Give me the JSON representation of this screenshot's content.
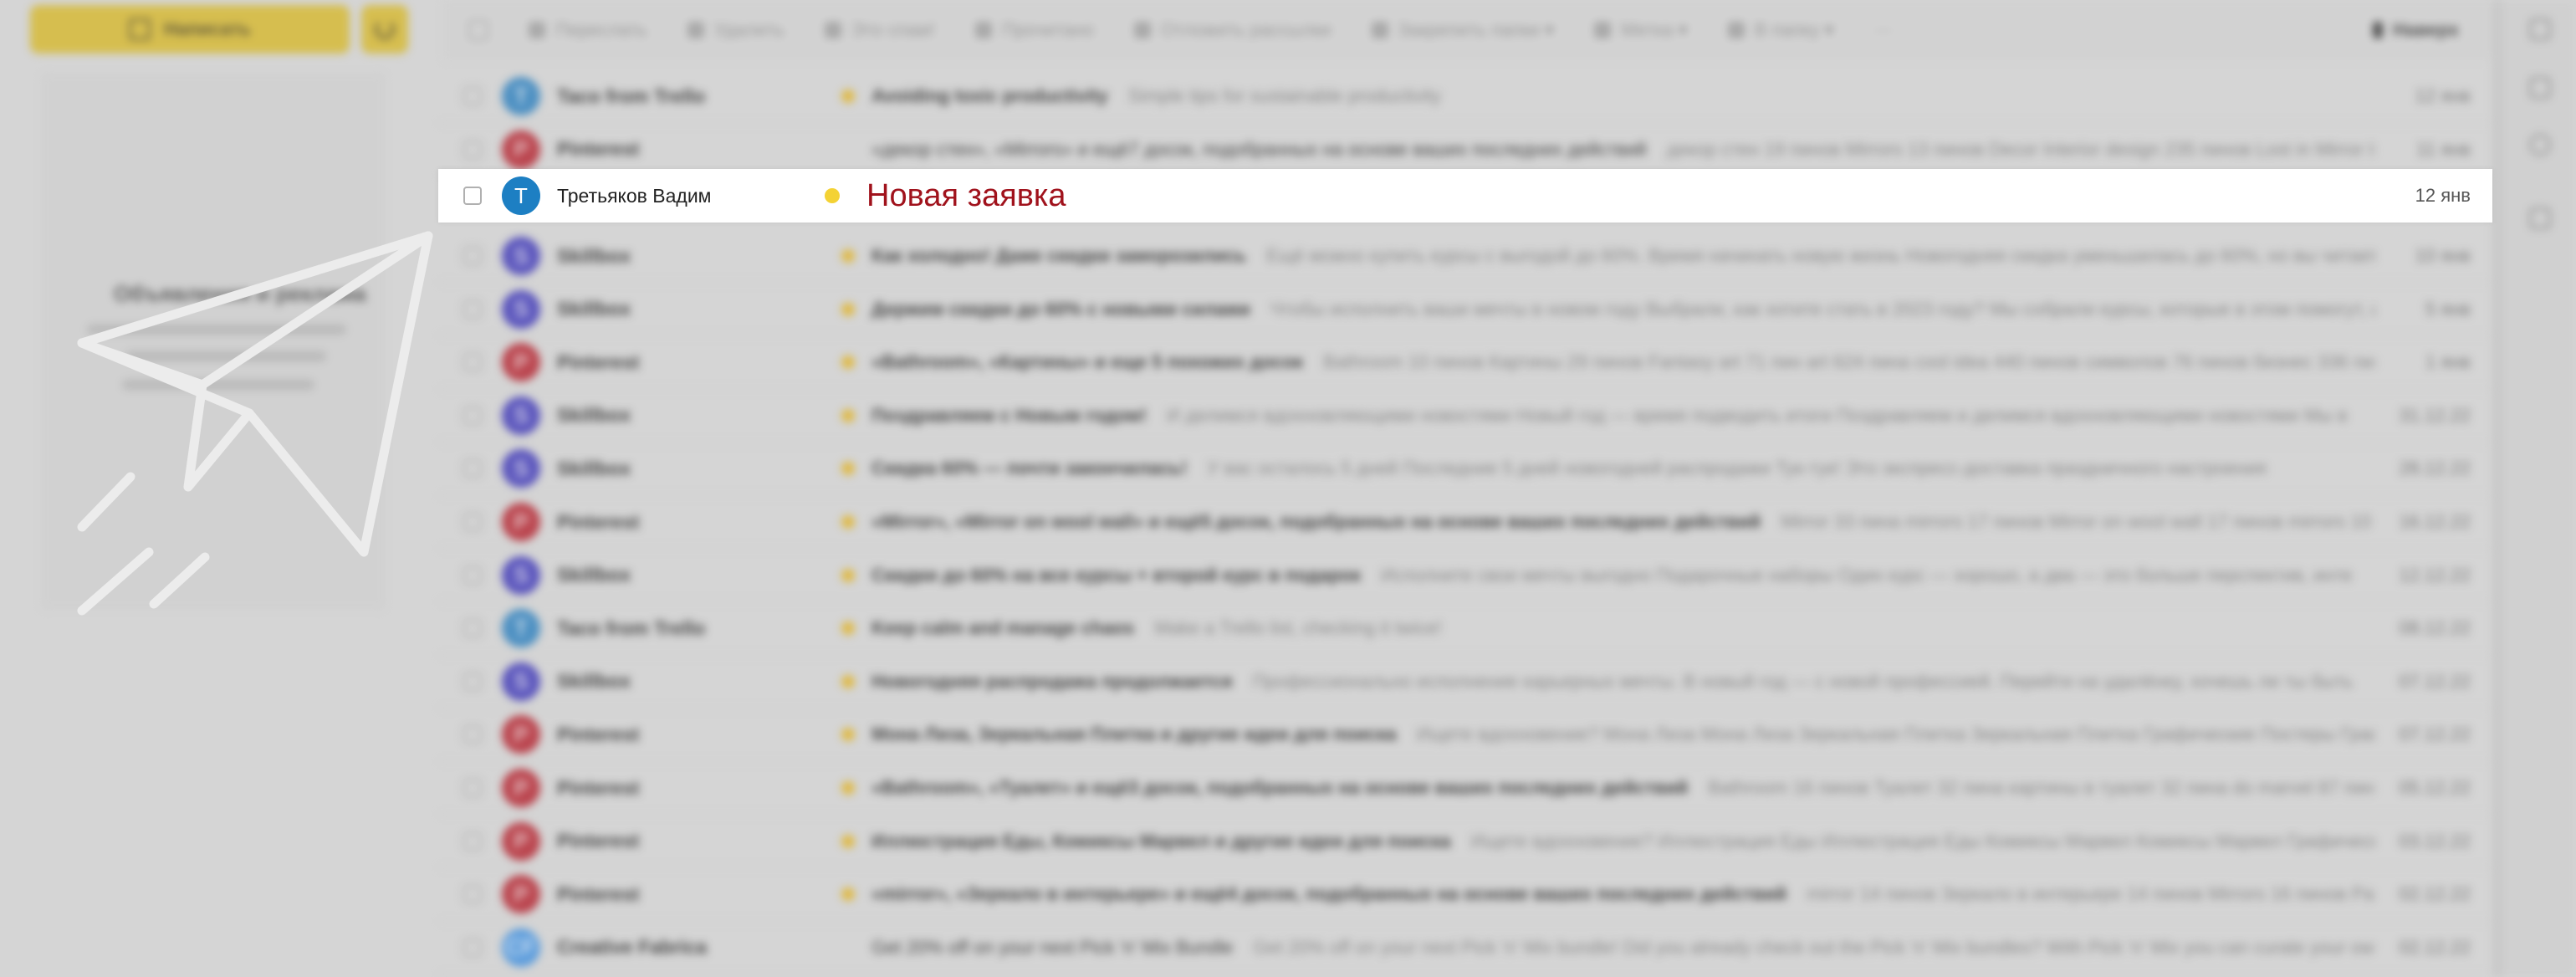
{
  "sidebar": {
    "compose_label": "Написать",
    "ad_title": "Объявления и реклама"
  },
  "toolbar": {
    "forward": "Переслать",
    "delete": "Удалить",
    "spam": "Это спам!",
    "read": "Прочитано",
    "pin": "Отложить рассылки",
    "reply_all": "Закрепить папки ▾",
    "labels": "Метка ▾",
    "to_folder": "В папку ▾",
    "more": "···",
    "tab_label": "Наверх"
  },
  "highlight": {
    "sender": "Третьяков Вадим",
    "avatar": "T",
    "avatar_color": "#1d7fc3",
    "subject": "Новая заявка",
    "subject_color": "#a0121c",
    "date": "12 янв"
  },
  "emails": [
    {
      "sender": "Taco from Trello",
      "avatar": "T",
      "color": "#2a7fbf",
      "subject": "Avoiding toxic productivity",
      "preview": "Simple tips for sustainable productivity",
      "date": "12 янв"
    },
    {
      "sender": "Pinterest",
      "avatar": "P",
      "color": "#b51f2b",
      "subject": "«декор стен», «Mirrors» и ещё7 досок, подобранных на основе ваших последних действий",
      "preview": "декор стен 19 пинов Mirrors 13 пинов Decor Interior design 235 пинов Lost in Mirror Infinity 14",
      "date": "11 янв",
      "plain": true
    },
    {
      "sender": "",
      "avatar": "",
      "color": "",
      "subject": "",
      "preview": "",
      "date": ""
    },
    {
      "sender": "Skillbox",
      "avatar": "S",
      "color": "#3b34b8",
      "subject": "Как холодно! Даже скидки заморозились",
      "preview": "Ещё можно купить курсы с выгодой до 60%. Время начинать новую жизнь Новогодняя скидка уменьшилась до 60%, но вы читаете это",
      "date": "10 янв"
    },
    {
      "sender": "Skillbox",
      "avatar": "S",
      "color": "#3b34b8",
      "subject": "Держим скидки до 60% с новыми силами",
      "preview": "Чтобы исполнить ваши мечты в новом году Выбрали, как хотите стать в 2023 году? Мы собрали курсы, которые в этом помогут, и до",
      "date": "5 янв"
    },
    {
      "sender": "Pinterest",
      "avatar": "P",
      "color": "#b51f2b",
      "subject": "«Bathroom», «Картины» и еще 5 похожих досок",
      "preview": "Bathroom 10 пинов Картины 29 пинов Fantasy art 71 пин art 624 пина cool idea 440 пинов символов 76 пинов бизнес 336 пинов Дру",
      "date": "1 янв"
    },
    {
      "sender": "Skillbox",
      "avatar": "S",
      "color": "#3b34b8",
      "subject": "Поздравляем с Новым годом!",
      "preview": "И делимся вдохновляющими новостями Новый год — время подводить итоги Поздравляем и делимся вдохновляющими новостями Мы в",
      "date": "31.12.22"
    },
    {
      "sender": "Skillbox",
      "avatar": "S",
      "color": "#3b34b8",
      "subject": "Скидка 60% — почти закончилась!",
      "preview": "У вас осталось 5 дней Последние 5 дней новогодней распродажи Тук-тук! Это экспресс-доставка праздничного настроения",
      "date": "28.12.22"
    },
    {
      "sender": "Pinterest",
      "avatar": "P",
      "color": "#b51f2b",
      "subject": "«Mirror», «Mirror on wool wall» и ещё5 досок, подобранных на основе ваших последних действий",
      "preview": "Mirror 33 пина mirrors 17 пинов Mirror on wool wall 17 пинов mirrors 10 пинов",
      "date": "16.12.22"
    },
    {
      "sender": "Skillbox",
      "avatar": "S",
      "color": "#3b34b8",
      "subject": "Скидки до 60% на все курсы + второй курс в подарок",
      "preview": "Исполните свои мечты выгодно Подарочные наборы Один курс — хорошо, а два — это больше перспектив, инте",
      "date": "12.12.22"
    },
    {
      "sender": "Taco from Trello",
      "avatar": "T",
      "color": "#2a7fbf",
      "subject": "Keep calm and manage chaos",
      "preview": "Make a Trello list, checking it twice!",
      "date": "08.12.22"
    },
    {
      "sender": "Skillbox",
      "avatar": "S",
      "color": "#3b34b8",
      "subject": "Новогодняя распродажа продолжается",
      "preview": "Профессионально исполнение карьерных мечты. В новый год — с новой профессией. Перейти на удалёнку, хочешь ли ты быть",
      "date": "07.12.22"
    },
    {
      "sender": "Pinterest",
      "avatar": "P",
      "color": "#b51f2b",
      "subject": "Мона Лиза, Зеркальная Плитка и другие идеи для поиска",
      "preview": "Ищете вдохновение? Мона Лиза Мона Лиза Зеркальная Плитка Зеркальная Плитка Графические Постеры Графически",
      "date": "07.12.22"
    },
    {
      "sender": "Pinterest",
      "avatar": "P",
      "color": "#b51f2b",
      "subject": "«Bathroom», «Туалет» и ещё3 досок, подобранных на основе ваших последних действий",
      "preview": "Bathroom 16 пинов Туалет 32 пина картины в туалет 32 пина do marvel 87 пинов бизн",
      "date": "05.12.22"
    },
    {
      "sender": "Pinterest",
      "avatar": "P",
      "color": "#b51f2b",
      "subject": "Иллюстрация Еды, Комиксы Марвел и другие идеи для поиска",
      "preview": "Ищете вдохновение? Иллюстрация Еды Иллюстрация Еды Комиксы Марвел Комиксы Марвел Графические Конц",
      "date": "03.12.22"
    },
    {
      "sender": "Pinterest",
      "avatar": "P",
      "color": "#b51f2b",
      "subject": "«mirror», «Зеркало в интерьере» и ещё4 досок, подобранных на основе ваших последних действий",
      "preview": "mirror 14 пинов Зеркало в интерьере 14 пинов Mirrors 16 пинов Painted G",
      "date": "02.12.22"
    },
    {
      "sender": "Creative Fabrica",
      "avatar": "CF",
      "color": "#3d8fe0",
      "subject": "Get 20% off on your next Pick 'n' Mix Bundle",
      "preview": "Get 20% off on your next Pick 'n' Mix bundle! Did you already check out the Pick 'n' Mix bundles? With Pick 'n' Mix you can curate your own bundl",
      "date": "02.12.22",
      "plain": true
    }
  ]
}
